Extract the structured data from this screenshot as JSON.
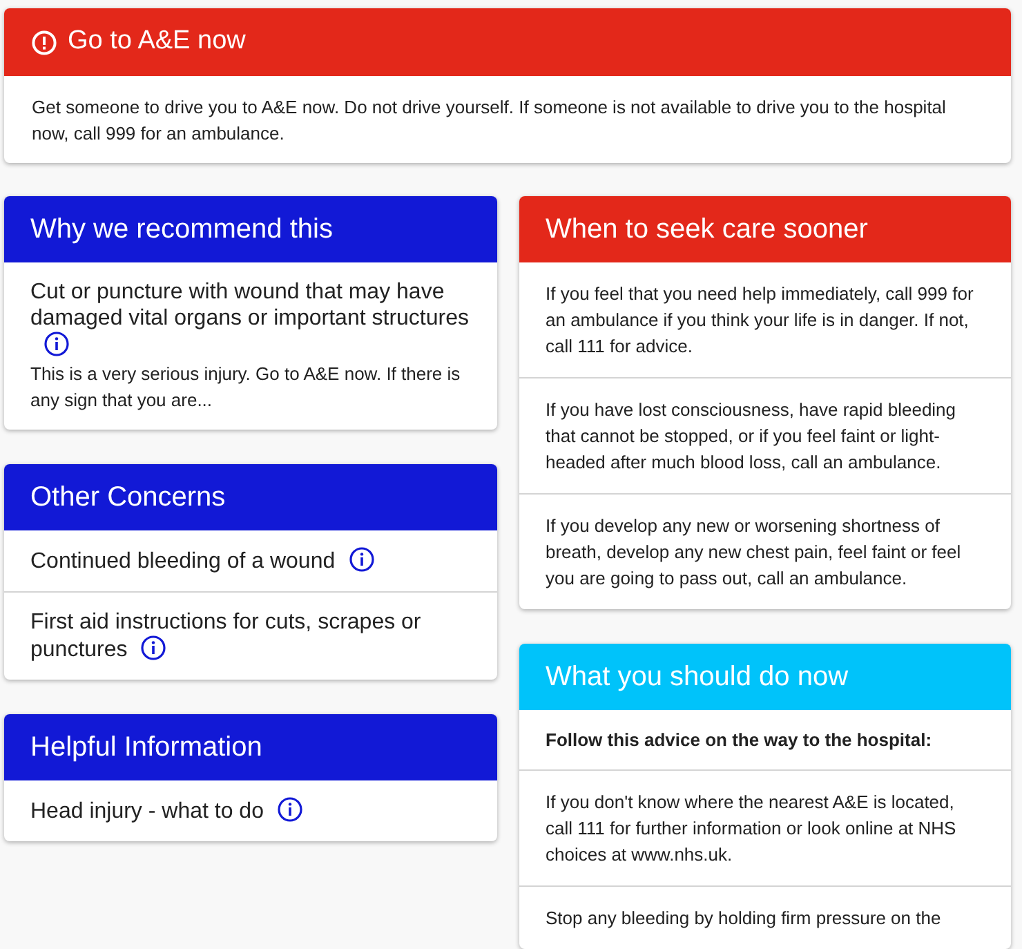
{
  "alert": {
    "title": "Go to A&E now",
    "message": "Get someone to drive you to A&E now. Do not drive yourself. If someone is not available to drive you to the hospital now, call 999 for an ambulance."
  },
  "left_column": [
    {
      "title": "Why we recommend this",
      "color": "#1219d6",
      "items": [
        {
          "text": "Cut or puncture with wound that may have damaged vital organs or important structures",
          "note": "This is a very serious injury. Go to A&E now. If there is any sign that you are..."
        }
      ]
    },
    {
      "title": "Other Concerns",
      "color": "#1219d6",
      "items": [
        {
          "text": "Continued bleeding of a wound"
        },
        {
          "text": "First aid instructions for cuts, scrapes or punctures"
        }
      ]
    },
    {
      "title": "Helpful Information",
      "color": "#1219d6",
      "items": [
        {
          "text": "Head injury - what to do"
        }
      ]
    }
  ],
  "right_column": [
    {
      "title": "When to seek care sooner",
      "color": "#e3281a",
      "items": [
        {
          "kind": "paragraph",
          "text": "If you feel that you need help immediately, call 999 for an ambulance if you think your life is in danger. If not, call 111 for advice."
        },
        {
          "kind": "paragraph",
          "text": "If you have lost consciousness, have rapid bleeding that cannot be stopped, or if you feel faint or light-headed after much blood loss, call an ambulance."
        },
        {
          "kind": "paragraph",
          "text": "If you develop any new or worsening shortness of breath, develop any new chest pain, feel faint or feel you are going to pass out, call an ambulance."
        }
      ]
    },
    {
      "title": "What you should do now",
      "color": "#00c3fa",
      "items": [
        {
          "kind": "heading",
          "text": "Follow this advice on the way to the hospital:"
        },
        {
          "kind": "paragraph",
          "text": "If you don't know where the nearest A&E is located, call 111 for further information or look online at NHS choices at www.nhs.uk."
        },
        {
          "kind": "paragraph",
          "text": "Stop any bleeding by holding firm pressure on the"
        }
      ]
    }
  ]
}
